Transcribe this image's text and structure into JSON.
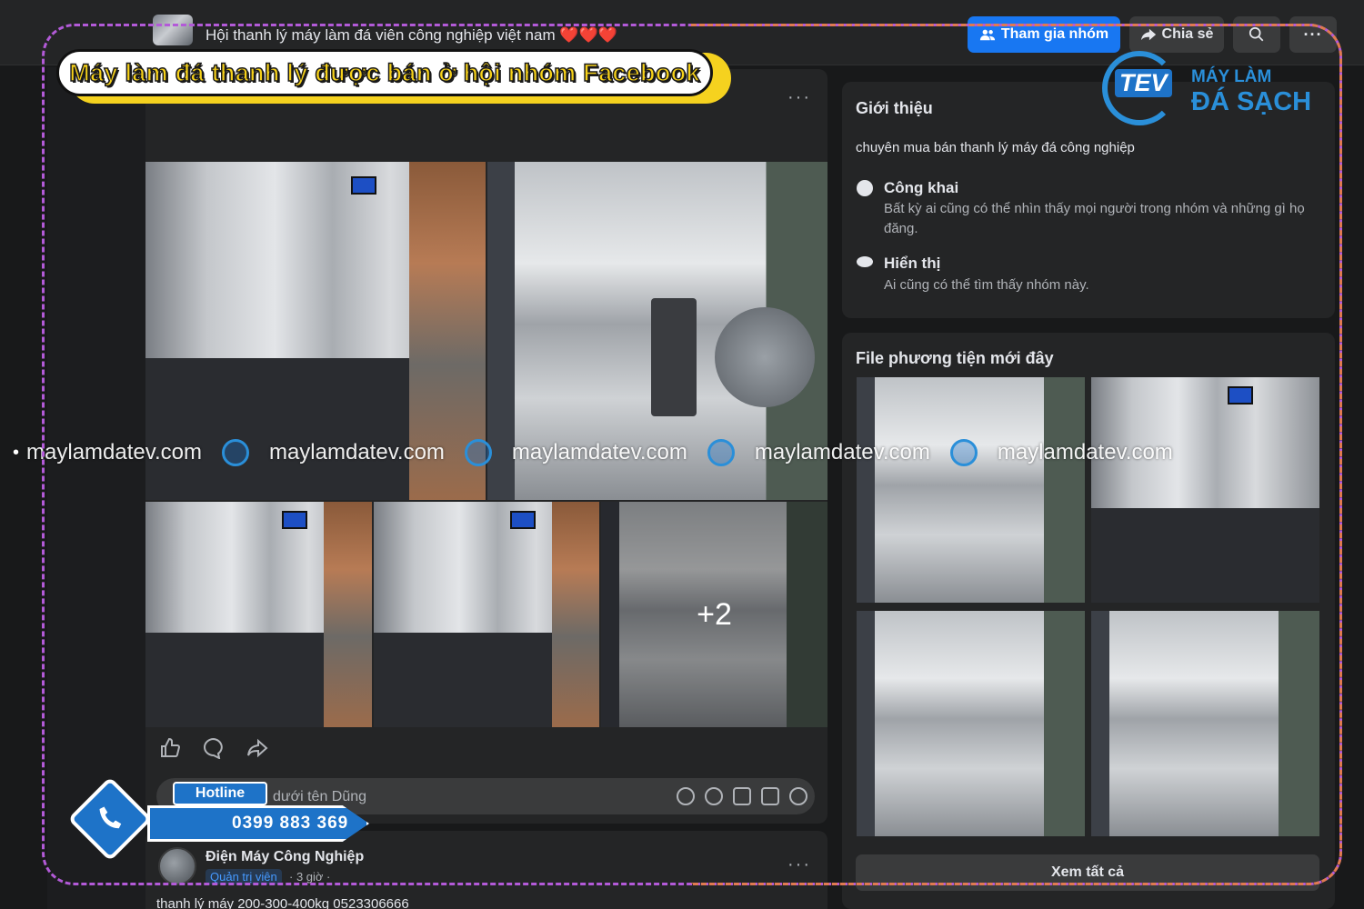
{
  "header": {
    "group_name": "Hội thanh lý máy làm đá viên công nghiệp việt nam ❤️❤️❤️",
    "join_button": "Tham gia nhóm",
    "share_button": "Chia sẻ",
    "join_icon": "group-icon",
    "share_icon": "share-icon",
    "search_icon": "search-icon",
    "more_icon": "more-icon"
  },
  "banner": {
    "text": "Máy làm đá thanh lý được bán ở hội nhóm Facebook"
  },
  "post": {
    "more": "···",
    "photo_overflow": "+2",
    "comment_placeholder": "dưới tên Dũng",
    "action_icons": [
      "like-icon",
      "comment-icon",
      "share-icon"
    ],
    "comment_icons": [
      "avatar-sticker-icon",
      "emoji-icon",
      "camera-icon",
      "gif-icon",
      "sticker-icon"
    ]
  },
  "post2": {
    "author": "Điện Máy Công Nghiệp",
    "role": "Quản trị viên",
    "time": "· 3 giờ ·",
    "more": "···",
    "text": "thanh lý máy 200-300-400kg 0523306666"
  },
  "about": {
    "title": "Giới thiệu",
    "description": "chuyên mua bán thanh lý máy đá công nghiệp",
    "public_title": "Công khai",
    "public_text": "Bất kỳ ai cũng có thể nhìn thấy mọi người trong nhóm và những gì họ đăng.",
    "visible_title": "Hiển thị",
    "visible_text": "Ai cũng có thể tìm thấy nhóm này."
  },
  "media": {
    "title": "File phương tiện mới đây",
    "see_all": "Xem tất cả"
  },
  "logo": {
    "brand": "TEV",
    "line1": "MÁY LÀM",
    "line2": "ĐÁ SẠCH"
  },
  "watermark": {
    "text": "maylamdatev.com"
  },
  "hotline": {
    "label": "Hotline",
    "number": "0399 883 369"
  },
  "colors": {
    "accent": "#1877f2",
    "brand": "#2a8fd9",
    "banner_fill": "#f5d21f"
  }
}
